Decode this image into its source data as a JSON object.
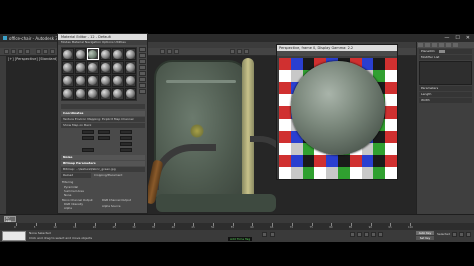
{
  "window": {
    "title": "office-chair - Autodesk 3ds Max 2019",
    "minimize": "—",
    "maximize": "☐",
    "close": "✕"
  },
  "viewport": {
    "label": "[+] [Perspective] [Standard] [Default Shading]"
  },
  "material_editor": {
    "title": "Material Editor - 12 - Default",
    "menu": "Modes Material Navigation Options Utilities",
    "slot_count": 24,
    "active_slot": 2,
    "rows": {
      "coordinates": "Coordinates",
      "mapping": "Texture  Environ  Mapping: Explicit Map Channel",
      "show_map": "Show Map on Back",
      "noise": "Noise",
      "bitmap_params": "Bitmap Parameters",
      "bitmap_path": "Bitmap: ...\\texture\\fabric_green.jpg",
      "reload": "Reload",
      "cropping": "Cropping/Placement",
      "filtering": "Filtering",
      "pyramidal": "Pyramidal",
      "summed_area": "Summed Area",
      "none": "None",
      "mono_output": "Mono Channel Output",
      "rgb_intensity": "RGB Intensity",
      "alpha": "Alpha",
      "rgb_channel": "RGB Channel Output",
      "alpha_source": "Alpha Source"
    }
  },
  "render_window": {
    "title": "Perspective, frame 0, Display Gamma: 2.2"
  },
  "right_panel": {
    "object_name": "Plane001",
    "modifier_list": "Modifier List",
    "params": "Parameters",
    "length": "Length",
    "width": "Width",
    "accent": "#8a8a8a"
  },
  "timeline": {
    "frame": "0 / 100",
    "ticks": [
      "0",
      "5",
      "10",
      "15",
      "20",
      "25",
      "30",
      "35",
      "40",
      "45",
      "50",
      "55",
      "60",
      "65",
      "70",
      "75",
      "80",
      "85",
      "90",
      "95",
      "100"
    ]
  },
  "statusbar": {
    "line1": "None Selected",
    "line2": "Click and drag to select and move objects",
    "key_badge": "Add Time Tag",
    "autokey": "Auto Key",
    "setkey": "Set Key",
    "selected": "Selected"
  },
  "render_checker_colors": [
    "#d03030",
    "#30a030",
    "#2a3fd0",
    "#ffffff",
    "#1a1a1a",
    "#c8c8c8"
  ]
}
